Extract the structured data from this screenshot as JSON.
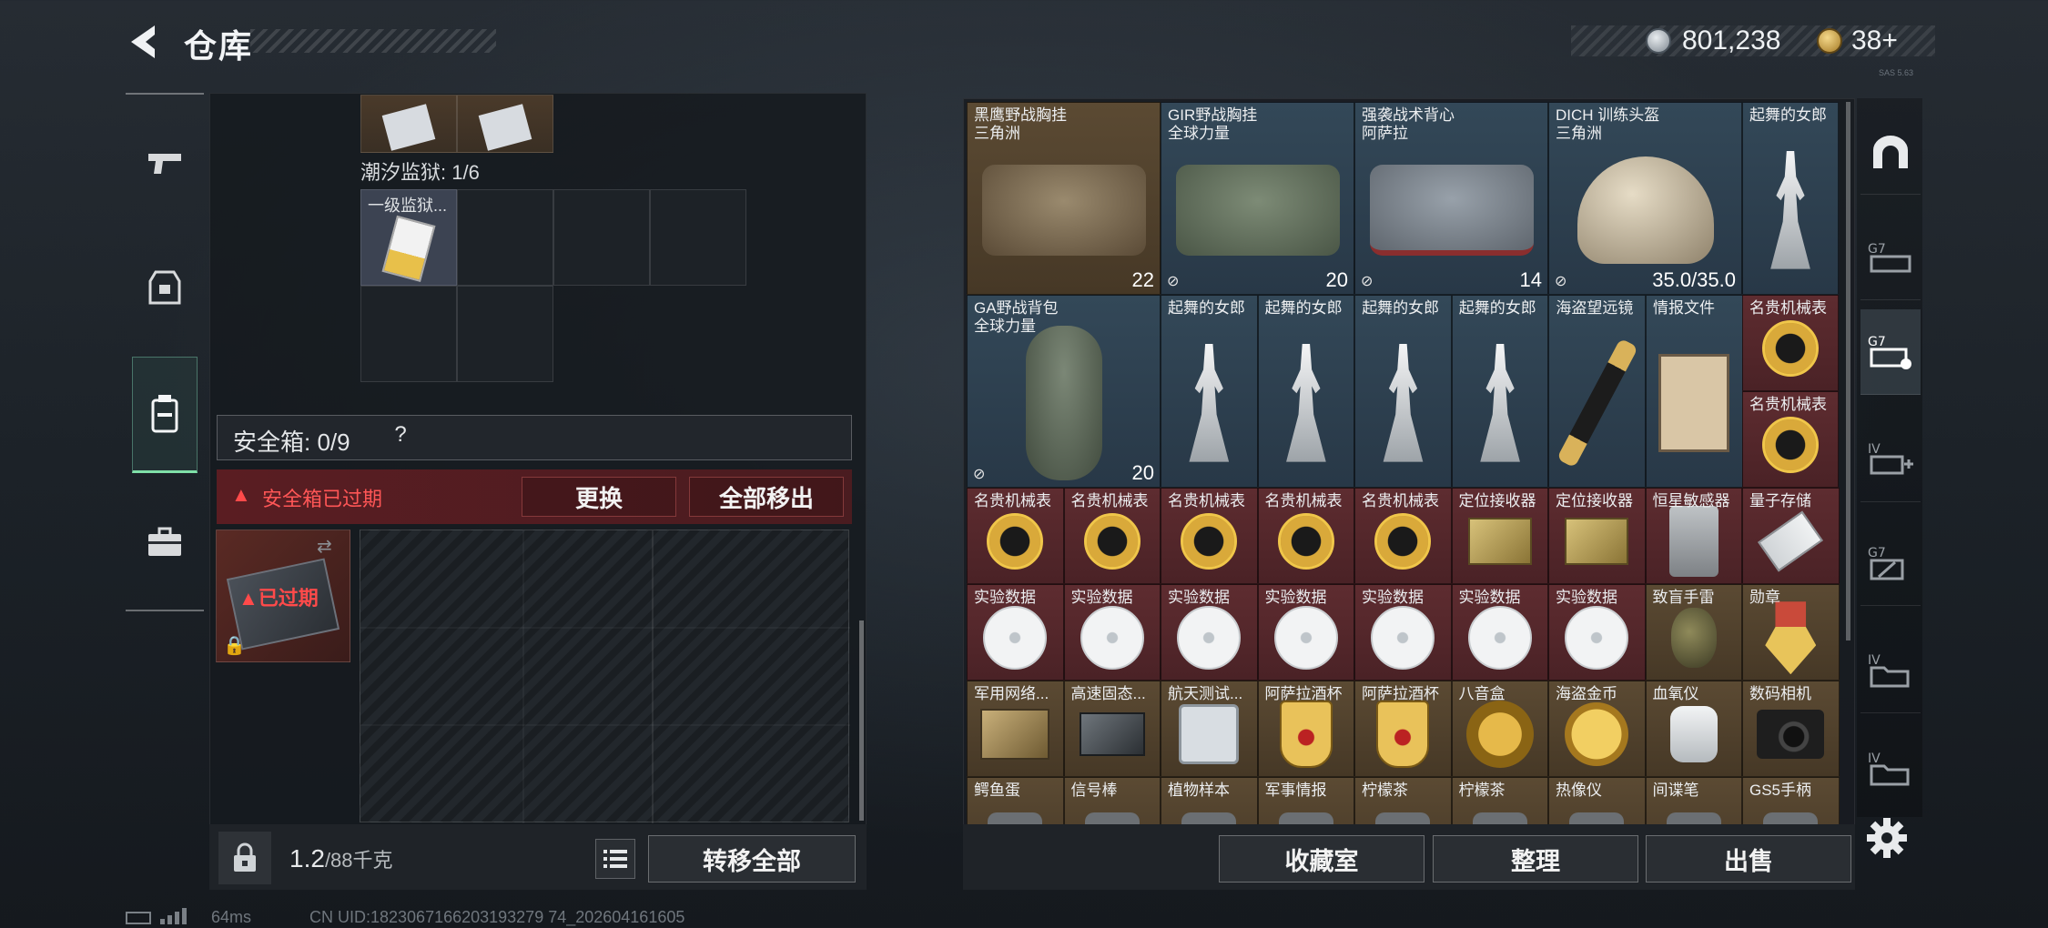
{
  "header": {
    "title": "仓库"
  },
  "currency": {
    "coins": "801,238",
    "tokens": "38",
    "tokens_plus": "+"
  },
  "version_tag": "SAS 5.63",
  "left_panel": {
    "tide_prison_label": "潮汐监狱: 1/6",
    "key_item_name": "一级监狱...",
    "safebox": {
      "label": "安全箱: 0/9",
      "help": "?",
      "expired_text": "安全箱已过期",
      "replace_label": "更换",
      "move_all_out_label": "全部移出",
      "thumb_expired_label": "已过期"
    },
    "bottom": {
      "weight": "1.2",
      "weight_cap": "/88千克",
      "transfer_all_label": "转移全部"
    }
  },
  "inventory": {
    "bottom_buttons": {
      "collection": "收藏室",
      "organize": "整理",
      "sell": "出售"
    },
    "items": [
      {
        "name": "黑鹰野战胸挂",
        "sub": "三角洲",
        "qty": "22",
        "rarity": "gold",
        "art": "bag tan",
        "flag": ""
      },
      {
        "name": "GIR野战胸挂",
        "sub": "全球力量",
        "qty": "20",
        "rarity": "blue",
        "art": "bag green",
        "flag": "⊘"
      },
      {
        "name": "强袭战术背心",
        "sub": "阿萨拉",
        "qty": "14",
        "rarity": "blue",
        "art": "bag grey",
        "flag": "⊘"
      },
      {
        "name": "DICH 训练头盔",
        "sub": "三角洲",
        "qty": "35.0/35.0",
        "rarity": "blue",
        "art": "helmet",
        "flag": "⊘"
      },
      {
        "name": "起舞的女郎",
        "sub": "",
        "qty": "",
        "rarity": "blue",
        "art": "statue",
        "flag": ""
      },
      {
        "name": "GA野战背包",
        "sub": "全球力量",
        "qty": "20",
        "rarity": "blue",
        "art": "duffel",
        "flag": "⊘"
      },
      {
        "name": "起舞的女郎",
        "sub": "",
        "qty": "",
        "rarity": "blue",
        "art": "statue",
        "flag": ""
      },
      {
        "name": "起舞的女郎",
        "sub": "",
        "qty": "",
        "rarity": "blue",
        "art": "statue",
        "flag": ""
      },
      {
        "name": "起舞的女郎",
        "sub": "",
        "qty": "",
        "rarity": "blue",
        "art": "statue",
        "flag": ""
      },
      {
        "name": "起舞的女郎",
        "sub": "",
        "qty": "",
        "rarity": "blue",
        "art": "statue",
        "flag": ""
      },
      {
        "name": "海盗望远镜",
        "sub": "",
        "qty": "",
        "rarity": "blue",
        "art": "scope",
        "flag": ""
      },
      {
        "name": "情报文件",
        "sub": "",
        "qty": "",
        "rarity": "blue",
        "art": "clipboard",
        "flag": ""
      },
      {
        "name": "名贵机械表",
        "sub": "",
        "qty": "",
        "rarity": "red",
        "art": "watch",
        "flag": ""
      },
      {
        "name": "名贵机械表",
        "sub": "",
        "qty": "",
        "rarity": "red",
        "art": "watch",
        "flag": ""
      },
      {
        "name": "名贵机械表",
        "sub": "",
        "qty": "",
        "rarity": "red",
        "art": "watch",
        "flag": ""
      },
      {
        "name": "名贵机械表",
        "sub": "",
        "qty": "",
        "rarity": "red",
        "art": "watch",
        "flag": ""
      },
      {
        "name": "名贵机械表",
        "sub": "",
        "qty": "",
        "rarity": "red",
        "art": "watch",
        "flag": ""
      },
      {
        "name": "名贵机械表",
        "sub": "",
        "qty": "",
        "rarity": "red",
        "art": "watch",
        "flag": ""
      },
      {
        "name": "名贵机械表",
        "sub": "",
        "qty": "",
        "rarity": "red",
        "art": "watch",
        "flag": ""
      },
      {
        "name": "定位接收器",
        "sub": "",
        "qty": "",
        "rarity": "red",
        "art": "device",
        "flag": ""
      },
      {
        "name": "定位接收器",
        "sub": "",
        "qty": "",
        "rarity": "red",
        "art": "device",
        "flag": ""
      },
      {
        "name": "恒星敏感器",
        "sub": "",
        "qty": "",
        "rarity": "red",
        "art": "sensor",
        "flag": ""
      },
      {
        "name": "量子存储",
        "sub": "",
        "qty": "",
        "rarity": "red",
        "art": "usb",
        "flag": ""
      },
      {
        "name": "实验数据",
        "sub": "",
        "qty": "",
        "rarity": "red",
        "art": "disc",
        "flag": ""
      },
      {
        "name": "实验数据",
        "sub": "",
        "qty": "",
        "rarity": "red",
        "art": "disc",
        "flag": ""
      },
      {
        "name": "实验数据",
        "sub": "",
        "qty": "",
        "rarity": "red",
        "art": "disc",
        "flag": ""
      },
      {
        "name": "实验数据",
        "sub": "",
        "qty": "",
        "rarity": "red",
        "art": "disc",
        "flag": ""
      },
      {
        "name": "实验数据",
        "sub": "",
        "qty": "",
        "rarity": "red",
        "art": "disc",
        "flag": ""
      },
      {
        "name": "实验数据",
        "sub": "",
        "qty": "",
        "rarity": "red",
        "art": "disc",
        "flag": ""
      },
      {
        "name": "实验数据",
        "sub": "",
        "qty": "",
        "rarity": "red",
        "art": "disc",
        "flag": ""
      },
      {
        "name": "致盲手雷",
        "sub": "",
        "qty": "",
        "rarity": "gold",
        "art": "grenade",
        "flag": ""
      },
      {
        "name": "勋章",
        "sub": "",
        "qty": "",
        "rarity": "gold",
        "art": "medal",
        "flag": ""
      },
      {
        "name": "军用网络...",
        "sub": "",
        "qty": "",
        "rarity": "gold",
        "art": "board",
        "flag": ""
      },
      {
        "name": "高速固态...",
        "sub": "",
        "qty": "",
        "rarity": "gold",
        "art": "ssd",
        "flag": ""
      },
      {
        "name": "航天测试...",
        "sub": "",
        "qty": "",
        "rarity": "gold",
        "art": "drive",
        "flag": ""
      },
      {
        "name": "阿萨拉酒杯",
        "sub": "",
        "qty": "",
        "rarity": "gold",
        "art": "cup",
        "flag": ""
      },
      {
        "name": "阿萨拉酒杯",
        "sub": "",
        "qty": "",
        "rarity": "gold",
        "art": "cup",
        "flag": ""
      },
      {
        "name": "八音盒",
        "sub": "",
        "qty": "",
        "rarity": "gold",
        "art": "box8",
        "flag": ""
      },
      {
        "name": "海盗金币",
        "sub": "",
        "qty": "",
        "rarity": "gold",
        "art": "coin-big",
        "flag": ""
      },
      {
        "name": "血氧仪",
        "sub": "",
        "qty": "",
        "rarity": "gold",
        "art": "oximeter",
        "flag": ""
      },
      {
        "name": "数码相机",
        "sub": "",
        "qty": "",
        "rarity": "gold",
        "art": "camera",
        "flag": ""
      },
      {
        "name": "鳄鱼蛋",
        "sub": "",
        "qty": "",
        "rarity": "gold",
        "art": "small-item",
        "flag": ""
      },
      {
        "name": "信号棒",
        "sub": "",
        "qty": "",
        "rarity": "gold",
        "art": "small-item",
        "flag": ""
      },
      {
        "name": "植物样本",
        "sub": "",
        "qty": "",
        "rarity": "gold",
        "art": "small-item",
        "flag": ""
      },
      {
        "name": "军事情报",
        "sub": "",
        "qty": "",
        "rarity": "gold",
        "art": "small-item",
        "flag": ""
      },
      {
        "name": "柠檬茶",
        "sub": "",
        "qty": "",
        "rarity": "gold",
        "art": "small-item",
        "flag": ""
      },
      {
        "name": "柠檬茶",
        "sub": "",
        "qty": "",
        "rarity": "gold",
        "art": "small-item",
        "flag": ""
      },
      {
        "name": "热像仪",
        "sub": "",
        "qty": "",
        "rarity": "gold",
        "art": "small-item",
        "flag": ""
      },
      {
        "name": "间谍笔",
        "sub": "",
        "qty": "",
        "rarity": "gold",
        "art": "small-item",
        "flag": ""
      },
      {
        "name": "GS5手柄",
        "sub": "",
        "qty": "",
        "rarity": "gold",
        "art": "small-item",
        "flag": ""
      }
    ]
  },
  "status_bar": {
    "ping": "64ms",
    "uid": "CN UID:1823067166203193279 74_202604161605"
  },
  "colors": {
    "accent_green": "#7fe0a8",
    "expired_red": "#ff4a4a",
    "rarity_gold": "#5b4a33",
    "rarity_red": "#5e2c30",
    "rarity_blue": "#334858"
  },
  "icons": {
    "left_tabs": [
      "pistol-icon",
      "armor-icon",
      "gear-icon",
      "briefcase-icon"
    ],
    "right_tabs": [
      "arch-icon",
      "storage-g7-icon",
      "storage-g7-expand-icon",
      "storage-iv-add-icon",
      "storage-g7-alt-icon",
      "storage-iv-folder-icon",
      "storage-iv-folder-2-icon"
    ]
  }
}
